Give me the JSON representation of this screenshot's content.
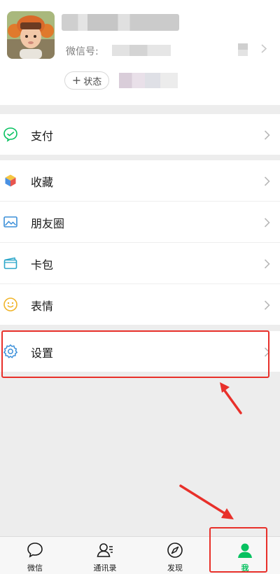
{
  "profile": {
    "wechat_id_label": "微信号:",
    "status_label": "状态"
  },
  "menu": {
    "pay": {
      "label": "支付",
      "icon": "wechat-pay-icon"
    },
    "favorites": {
      "label": "收藏",
      "icon": "favorites-cube-icon"
    },
    "moments": {
      "label": "朋友圈",
      "icon": "photo-album-icon"
    },
    "card_wallet": {
      "label": "卡包",
      "icon": "card-wallet-icon"
    },
    "stickers": {
      "label": "表情",
      "icon": "smiley-icon"
    },
    "settings": {
      "label": "设置",
      "icon": "gear-icon"
    }
  },
  "tabbar": {
    "chats": "微信",
    "contacts": "通讯录",
    "discover": "发现",
    "me": "我",
    "active_tab": "me"
  },
  "colors": {
    "accent_green": "#07c160",
    "annotation_red": "#e8302a",
    "page_background": "#ededed"
  }
}
